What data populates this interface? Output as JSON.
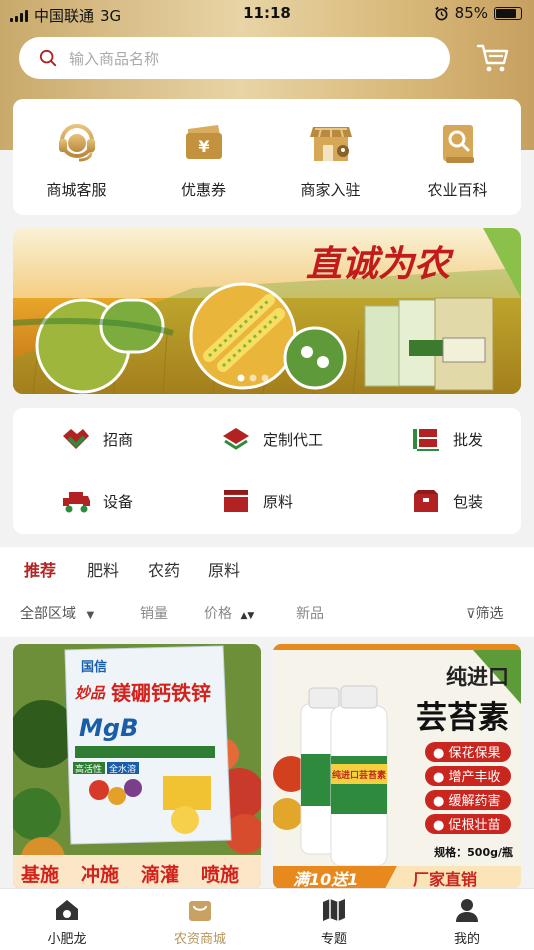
{
  "status_bar": {
    "carrier": "中国联通",
    "network": "3G",
    "time": "11:18",
    "battery": "85%"
  },
  "search": {
    "placeholder": "输入商品名称"
  },
  "quick_entries": [
    {
      "label": "商城客服",
      "icon": "headset-icon"
    },
    {
      "label": "优惠券",
      "icon": "coupon-icon"
    },
    {
      "label": "商家入驻",
      "icon": "store-icon"
    },
    {
      "label": "农业百科",
      "icon": "encyclopedia-icon"
    }
  ],
  "banner": {
    "headline": "直诚为农"
  },
  "menu": [
    {
      "label": "招商",
      "icon": "handshake-icon"
    },
    {
      "label": "定制代工",
      "icon": "layers-icon"
    },
    {
      "label": "批发",
      "icon": "wholesale-icon"
    },
    {
      "label": "设备",
      "icon": "truck-icon"
    },
    {
      "label": "原料",
      "icon": "box-icon"
    },
    {
      "label": "包装",
      "icon": "package-icon"
    }
  ],
  "tabs": [
    "推荐",
    "肥料",
    "农药",
    "原料"
  ],
  "filters": {
    "region": "全部区域",
    "sales": "销量",
    "price": "价格",
    "new": "新品",
    "filter": "筛选"
  },
  "products": [
    {
      "brand": "国信",
      "series": "妙品",
      "name": "镁硼钙铁锌",
      "code": "MgB",
      "tags": [
        "高活性",
        "全水溶"
      ],
      "methods": [
        "基施",
        "冲施",
        "滴灌",
        "喷施"
      ]
    },
    {
      "title_top": "纯进口",
      "title_main": "芸苔素",
      "bottle_label": "纯进口芸苔素",
      "features": [
        "保花保果",
        "增产丰收",
        "缓解药害",
        "促根壮苗"
      ],
      "spec": "规格：500g/瓶",
      "promo_left": "满10送1",
      "promo_right": "厂家直销"
    }
  ],
  "bottom_nav": [
    {
      "label": "小肥龙",
      "icon": "home-icon"
    },
    {
      "label": "农资商城",
      "icon": "mall-bag-icon"
    },
    {
      "label": "专题",
      "icon": "map-icon"
    },
    {
      "label": "我的",
      "icon": "user-icon"
    }
  ],
  "colors": {
    "accent_red": "#b22222",
    "gold": "#c9a96b",
    "nav_active": "#b8955a"
  }
}
